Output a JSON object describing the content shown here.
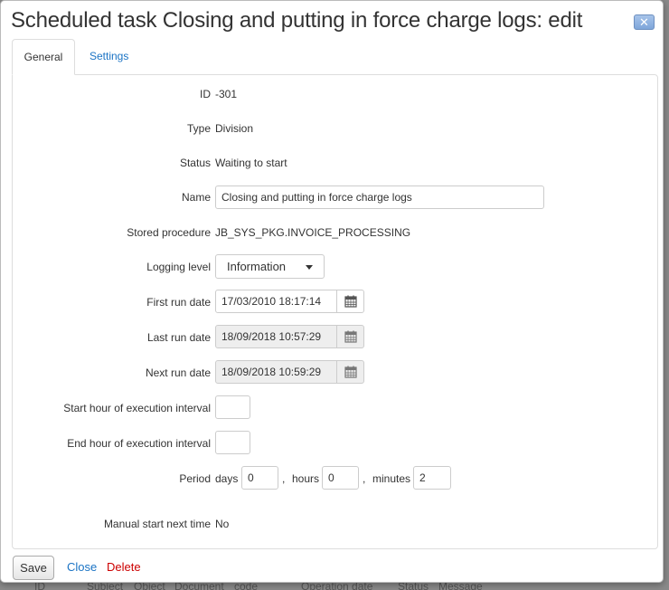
{
  "dialog": {
    "title": "Scheduled task Closing and putting in force charge logs: edit",
    "close_glyph": "✕"
  },
  "tabs": [
    {
      "label": "General",
      "active": true
    },
    {
      "label": "Settings",
      "active": false
    }
  ],
  "fields": {
    "id": {
      "label": "ID",
      "value": "-301"
    },
    "type": {
      "label": "Type",
      "value": "Division"
    },
    "status": {
      "label": "Status",
      "value": "Waiting to start"
    },
    "name": {
      "label": "Name",
      "value": "Closing and putting in force charge logs"
    },
    "stored_procedure": {
      "label": "Stored procedure",
      "value": "JB_SYS_PKG.INVOICE_PROCESSING"
    },
    "logging_level": {
      "label": "Logging level",
      "value": "Information"
    },
    "first_run_date": {
      "label": "First run date",
      "value": "17/03/2010 18:17:14"
    },
    "last_run_date": {
      "label": "Last run date",
      "value": "18/09/2018 10:57:29"
    },
    "next_run_date": {
      "label": "Next run date",
      "value": "18/09/2018 10:59:29"
    },
    "start_hour": {
      "label": "Start hour of execution interval",
      "value": ""
    },
    "end_hour": {
      "label": "End hour of execution interval",
      "value": ""
    },
    "period": {
      "label": "Period",
      "days_label": "days",
      "days": "0",
      "hours_label": "hours",
      "hours": "0",
      "minutes_label": "minutes",
      "minutes": "2",
      "separator": ","
    },
    "manual_start": {
      "label": "Manual start next time",
      "value": "No"
    }
  },
  "footer": {
    "save_label": "Save",
    "close_label": "Close",
    "delete_label": "Delete"
  },
  "background_table_headers": [
    "ID",
    "Subject",
    "Object",
    "Document",
    "code",
    "Operation date",
    "Status",
    "Message"
  ],
  "colors": {
    "link": "#1a73c4",
    "delete": "#cc0000",
    "readonly_bg": "#eeeeee"
  }
}
